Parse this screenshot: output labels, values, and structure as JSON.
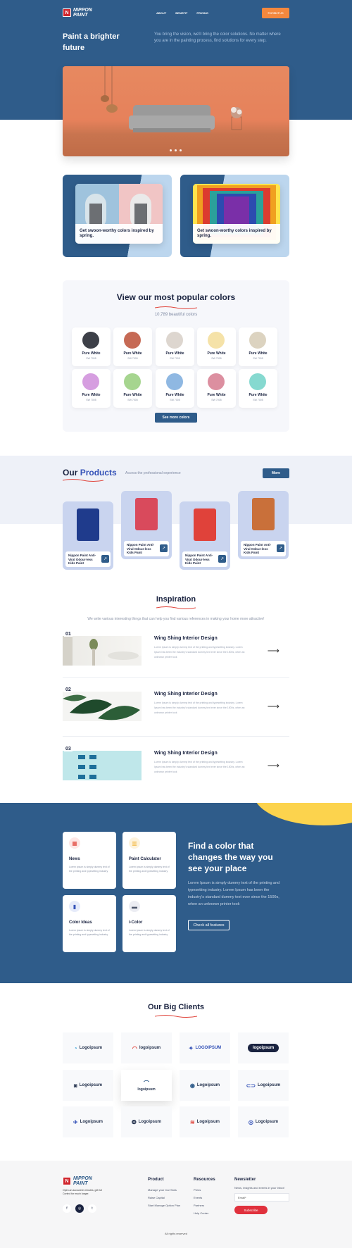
{
  "nav": {
    "brand": "NIPPON\nPAINT",
    "brand_mark": "N",
    "links": [
      "ABOUT",
      "BENEFIT",
      "PRICING"
    ],
    "contact": "Contact Us"
  },
  "hero": {
    "title": "Paint a brighter future",
    "subtitle": "You bring the vision, we'll bring the color solutions. No matter where you are in the painting process, find solutions for every step."
  },
  "spring_cards": [
    {
      "caption": "Get swoon-worthy colors inspired by spring."
    },
    {
      "caption": "Get swoon-worthy colors inspired by spring."
    }
  ],
  "popular": {
    "title": "View our most popular colors",
    "subtitle": "10,789 beautiful colors",
    "button": "See more colors",
    "swatches": [
      {
        "name": "Pure White",
        "code": "SW 7005",
        "color": "#3d4048"
      },
      {
        "name": "Pure White",
        "code": "SW 7005",
        "color": "#c66a55"
      },
      {
        "name": "Pure White",
        "code": "SW 7005",
        "color": "#ddd6cf"
      },
      {
        "name": "Pure White",
        "code": "SW 7005",
        "color": "#f5e2a8"
      },
      {
        "name": "Pure White",
        "code": "SW 7005",
        "color": "#dcd3c0"
      },
      {
        "name": "Pure White",
        "code": "SW 7005",
        "color": "#d69ee0"
      },
      {
        "name": "Pure White",
        "code": "SW 7005",
        "color": "#a6d58f"
      },
      {
        "name": "Pure White",
        "code": "SW 7005",
        "color": "#8fb8e2"
      },
      {
        "name": "Pure White",
        "code": "SW 7005",
        "color": "#dc8fa0"
      },
      {
        "name": "Pure White",
        "code": "SW 7005",
        "color": "#86d9d0"
      }
    ]
  },
  "products": {
    "title_a": "Our",
    "title_b": "Products",
    "subtitle": "Access the professional experience",
    "more": "More",
    "items": [
      {
        "label": "Nippon Paint Anti-Viral Odour-less Kids Paint",
        "can": "#1f3b8c"
      },
      {
        "label": "Nippon Paint Anti-Viral Odour-less Kids Paint",
        "can": "#d94a5c"
      },
      {
        "label": "Nippon Paint Anti-Viral Odour-less Kids Paint",
        "can": "#e0423a"
      },
      {
        "label": "Nippon Paint Anti-Viral Odour-less Kids Paint",
        "can": "#c9703a"
      }
    ]
  },
  "inspiration": {
    "title": "Inspiration",
    "subtitle": "We write various interesting things that can help you find various references in making your home more attractive!",
    "items": [
      {
        "num": "01",
        "title": "Wing Shing Interior Design",
        "body": "Lorem Ipsum is simply dummy text of the printing and typesetting industry. Lorem Ipsum has been the industry's standard dummy text ever since the 1500s, when an unknown printer took"
      },
      {
        "num": "02",
        "title": "Wing Shing Interior Design",
        "body": "Lorem Ipsum is simply dummy text of the printing and typesetting industry. Lorem Ipsum has been the industry's standard dummy text ever since the 1500s, when an unknown printer took"
      },
      {
        "num": "03",
        "title": "Wing Shing Interior Design",
        "body": "Lorem Ipsum is simply dummy text of the printing and typesetting industry. Lorem Ipsum has been the industry's standard dummy text ever since the 1500s, when an unknown printer took"
      }
    ]
  },
  "features": {
    "title": "Find a color that changes the way you see your place",
    "body": "Lorem Ipsum is simply dummy text of the printing and typesetting industry. Lorem Ipsum has been the industry's standard dummy text ever since the 1500s, when an unknown printer took",
    "button": "Check all features",
    "cards": [
      {
        "title": "News",
        "body": "Lorem ipsum is simply dummy text of the printing and typesetting industry",
        "icon": "news-icon"
      },
      {
        "title": "Paint Calculator",
        "body": "Lorem ipsum is simply dummy text of the printing and typesetting industry",
        "icon": "calculator-icon"
      },
      {
        "title": "Color Ideas",
        "body": "Lorem ipsum is simply dummy text of the printing and typesetting industry",
        "icon": "bookmark-icon"
      },
      {
        "title": "i-Color",
        "body": "Lorem ipsum is simply dummy text of the printing and typesetting industry",
        "icon": "chat-icon"
      }
    ]
  },
  "clients": {
    "title": "Our Big Clients",
    "logos": [
      "Logoipsum",
      "logoipsum",
      "LOGOIPSUM",
      "logoipsum",
      "Logoipsum",
      "logoipsum",
      "Logoipsum",
      "Logoipsum",
      "Logoipsum",
      "Logoipsum",
      "Logoipsum",
      "Logoipsum"
    ]
  },
  "footer": {
    "tagline": "Open an account in minutes, get full Control for much longer.",
    "product_h": "Product",
    "product_items": [
      "Manage your Car Slots",
      "Raise Capital",
      "Start Manage Option Plan"
    ],
    "resources_h": "Resources",
    "resources_items": [
      "Press",
      "Events",
      "Partners",
      "Help Center"
    ],
    "newsletter_h": "Newsletter",
    "newsletter_sub": "News, insights and events in your inbox!",
    "email_placeholder": "Email*",
    "subscribe": "Subscribe",
    "copyright": "All rights reserved"
  }
}
